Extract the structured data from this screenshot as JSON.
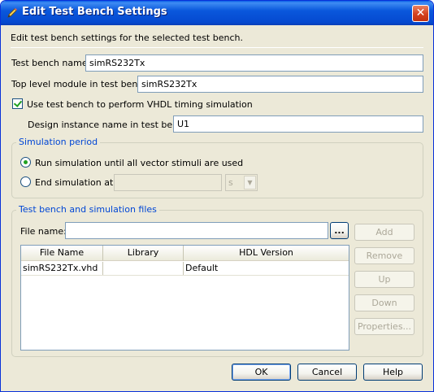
{
  "window": {
    "title": "Edit Test Bench Settings",
    "close_glyph": "✕"
  },
  "description": "Edit test bench settings for the selected test bench.",
  "fields": {
    "test_bench_name_label": "Test bench name:",
    "test_bench_name_value": "simRS232Tx",
    "top_level_label": "Top level module in test bench:",
    "top_level_value": "simRS232Tx",
    "use_timing_label": "Use test bench to perform VHDL timing simulation",
    "design_instance_label": "Design instance name in test bench:",
    "design_instance_value": "U1"
  },
  "simulation_period": {
    "title": "Simulation period",
    "run_until_label": "Run simulation until all vector stimuli are used",
    "end_at_label": "End simulation at:",
    "end_at_value": "",
    "unit_value": "s",
    "selected": "run_until"
  },
  "files": {
    "title": "Test bench and simulation files",
    "file_name_label": "File name:",
    "file_name_value": "",
    "browse_label": "...",
    "columns": [
      "File Name",
      "Library",
      "HDL Version"
    ],
    "rows": [
      {
        "file_name": "simRS232Tx.vhd",
        "library": "",
        "hdl_version": "Default"
      }
    ],
    "buttons": {
      "add": "Add",
      "remove": "Remove",
      "up": "Up",
      "down": "Down",
      "properties": "Properties..."
    }
  },
  "footer": {
    "ok": "OK",
    "cancel": "Cancel",
    "help": "Help"
  },
  "colors": {
    "title_bar": "#0a58dc",
    "group_title": "#0046d5",
    "check": "#21a121"
  },
  "icons": {
    "title": "pencil-icon",
    "close": "close-icon",
    "dropdown": "chevron-down-icon"
  }
}
